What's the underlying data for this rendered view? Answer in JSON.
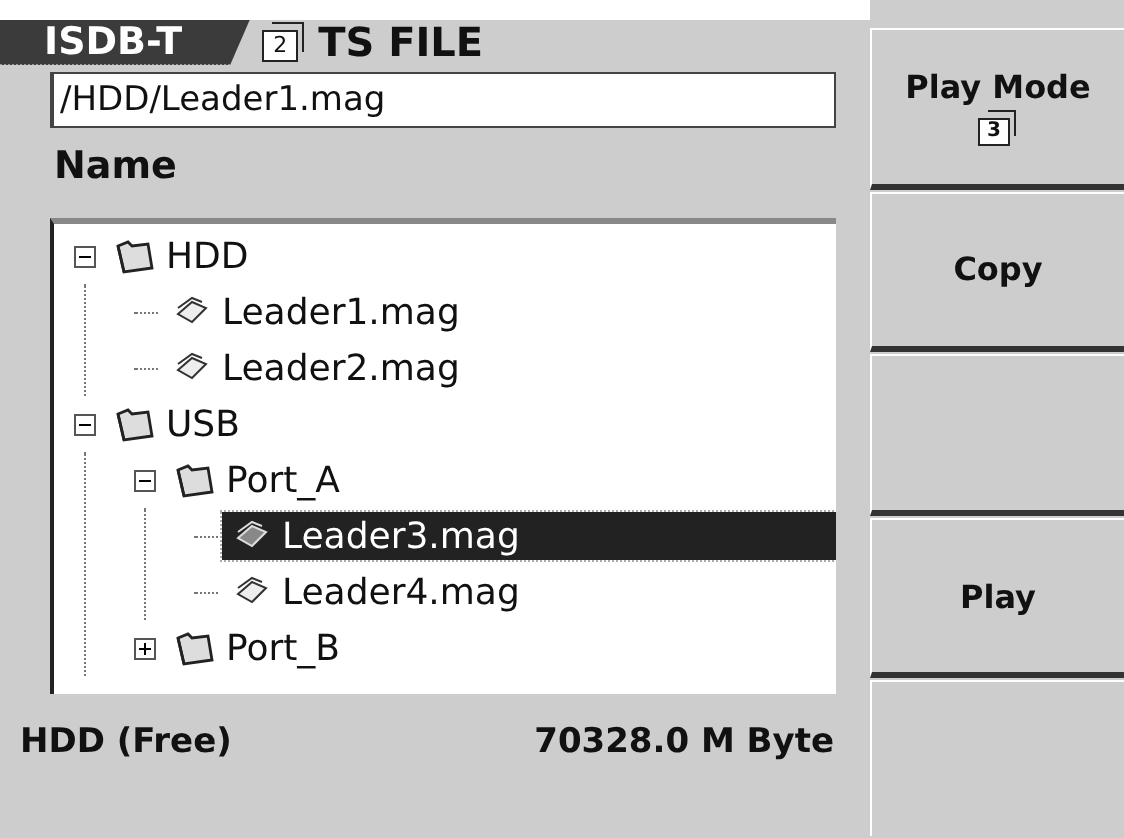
{
  "header": {
    "mode_tab": "ISDB-T",
    "page_number": "2",
    "title": "TS FILE"
  },
  "path_field": {
    "value": "/HDD/Leader1.mag"
  },
  "column_header": "Name",
  "tree": [
    {
      "name": "HDD",
      "kind": "folder",
      "expanded": true,
      "selected": false,
      "children": [
        {
          "name": "Leader1.mag",
          "kind": "file",
          "selected": false
        },
        {
          "name": "Leader2.mag",
          "kind": "file",
          "selected": false
        }
      ]
    },
    {
      "name": "USB",
      "kind": "folder",
      "expanded": true,
      "selected": false,
      "children": [
        {
          "name": "Port_A",
          "kind": "folder",
          "expanded": true,
          "selected": false,
          "children": [
            {
              "name": "Leader3.mag",
              "kind": "file",
              "selected": true
            },
            {
              "name": "Leader4.mag",
              "kind": "file",
              "selected": false
            }
          ]
        },
        {
          "name": "Port_B",
          "kind": "folder",
          "expanded": false,
          "selected": false
        }
      ]
    }
  ],
  "status_bar": {
    "label": "HDD (Free)",
    "value": "70328.0 M Byte"
  },
  "soft_keys": [
    {
      "kind": "labeled",
      "label": "Play Mode",
      "page_number": "3"
    },
    {
      "kind": "labeled",
      "label": "Copy"
    },
    {
      "kind": "blank"
    },
    {
      "kind": "labeled",
      "label": "Play"
    },
    {
      "kind": "blank"
    }
  ]
}
